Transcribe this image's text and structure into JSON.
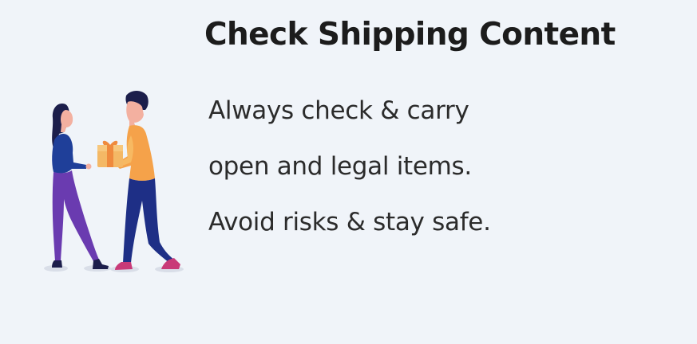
{
  "card": {
    "title": "Check Shipping Content",
    "lines": [
      "Always check & carry",
      "open and legal items.",
      "Avoid risks & stay safe."
    ],
    "illustration": "two-people-handing-package",
    "colors": {
      "background": "#f0f4f9",
      "title": "#1c1c1c",
      "body_text": "#2b2b2b",
      "package": "#f4b865",
      "woman_top": "#1f3f99",
      "woman_pants": "#6a3bb0",
      "man_shirt": "#f5a24a",
      "man_pants": "#1e2f86",
      "shoes": "#c93a78"
    }
  }
}
